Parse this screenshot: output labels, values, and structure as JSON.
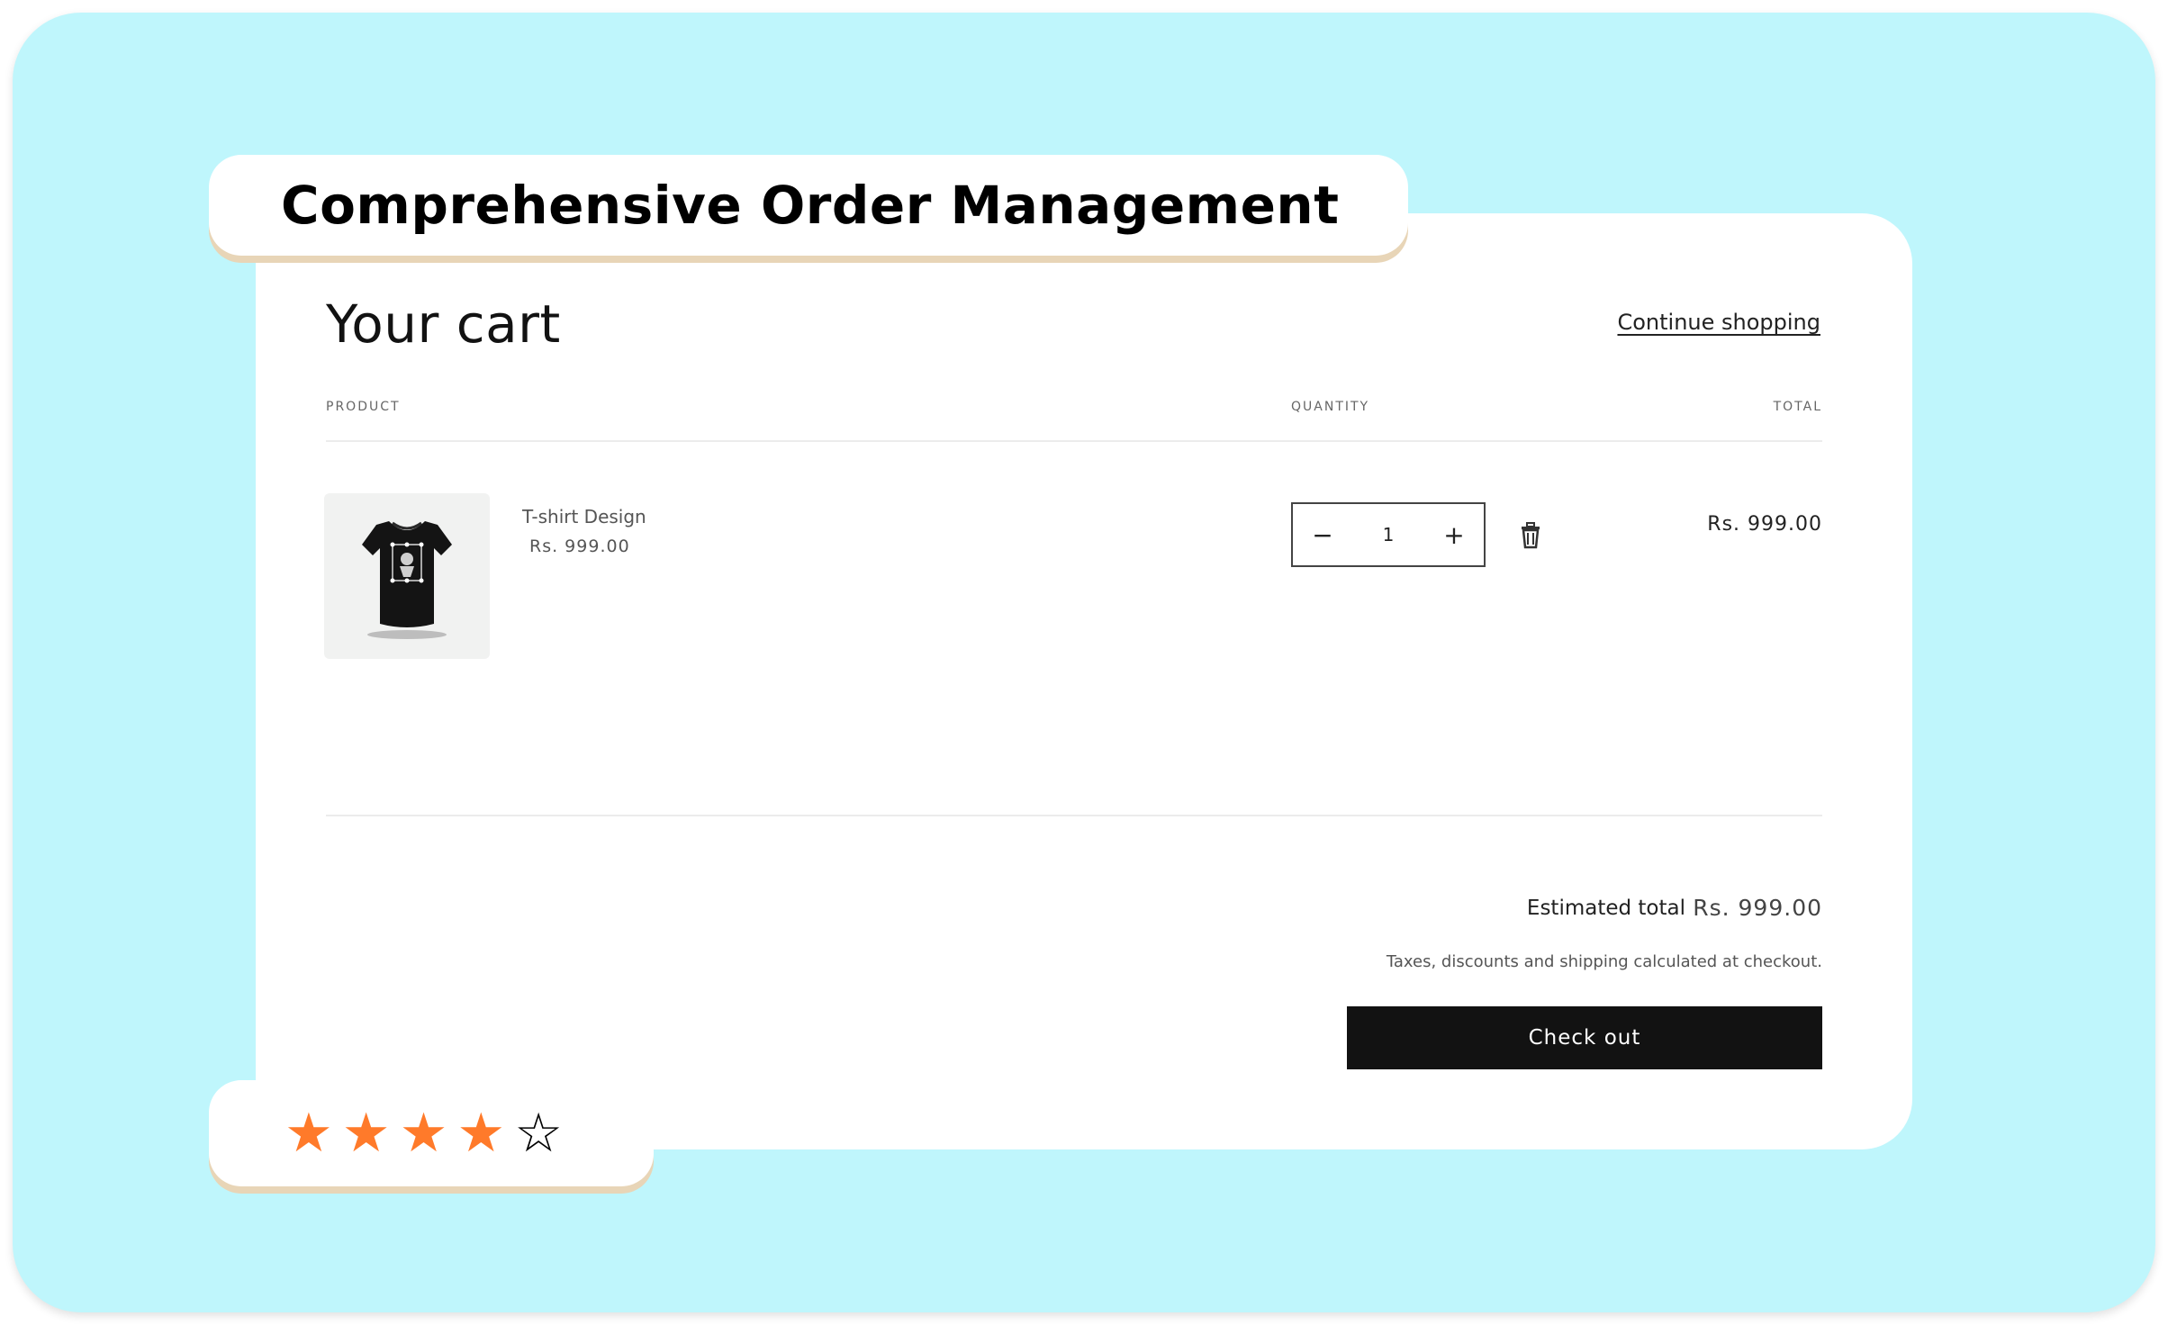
{
  "banner": {
    "title": "Comprehensive Order Management"
  },
  "rating": {
    "value": 4,
    "max": 5,
    "filled_color": "#ff7a2a"
  },
  "cart": {
    "title": "Your cart",
    "continue_link": "Continue shopping",
    "columns": {
      "product": "PRODUCT",
      "quantity": "QUANTITY",
      "total": "TOTAL"
    },
    "items": [
      {
        "name": "T-shirt Design",
        "price": "Rs. 999.00",
        "quantity": "1",
        "line_total": "Rs. 999.00",
        "thumbnail_icon": "tshirt-icon"
      }
    ],
    "quantity_controls": {
      "minus": "−",
      "plus": "+",
      "remove_icon": "trash-icon"
    },
    "summary": {
      "estimated_total_label": "Estimated total",
      "estimated_total_value": "Rs. 999.00",
      "note": "Taxes, discounts and shipping calculated at checkout.",
      "checkout_label": "Check out"
    }
  },
  "colors": {
    "background": "#bff6fc",
    "accent_shadow": "#e8d5b7",
    "checkout_button": "#121212"
  }
}
